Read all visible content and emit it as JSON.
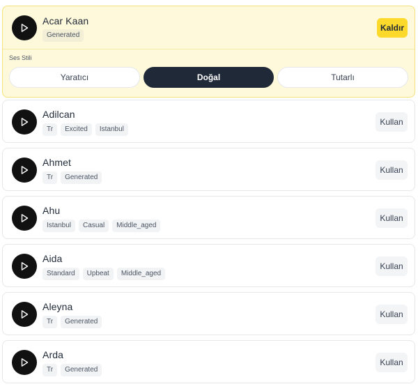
{
  "selected_voice": {
    "name": "Acar Kaan",
    "tags": [
      "Generated"
    ],
    "remove_label": "Kaldır",
    "style_label": "Ses Stili",
    "styles": [
      {
        "label": "Yaratıcı",
        "active": false
      },
      {
        "label": "Doğal",
        "active": true
      },
      {
        "label": "Tutarlı",
        "active": false
      }
    ]
  },
  "use_label": "Kullan",
  "voices": [
    {
      "name": "Adilcan",
      "tags": [
        "Tr",
        "Excited",
        "Istanbul"
      ]
    },
    {
      "name": "Ahmet",
      "tags": [
        "Tr",
        "Generated"
      ]
    },
    {
      "name": "Ahu",
      "tags": [
        "Istanbul",
        "Casual",
        "Middle_aged"
      ]
    },
    {
      "name": "Aida",
      "tags": [
        "Standard",
        "Upbeat",
        "Middle_aged"
      ]
    },
    {
      "name": "Aleyna",
      "tags": [
        "Tr",
        "Generated"
      ]
    },
    {
      "name": "Arda",
      "tags": [
        "Tr",
        "Generated"
      ]
    }
  ],
  "icons": {
    "play": "play-icon"
  },
  "colors": {
    "accent": "#fcd92a",
    "selected_bg": "#fff9db",
    "dark": "#1f2937"
  }
}
